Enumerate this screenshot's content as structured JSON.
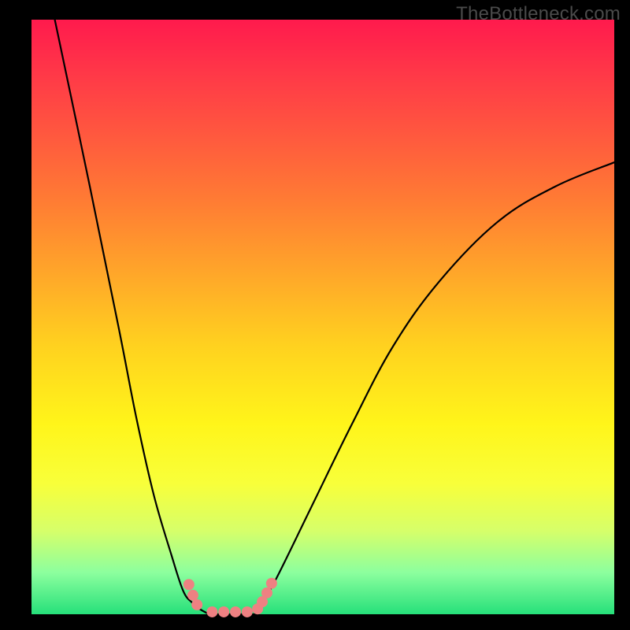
{
  "watermark": "TheBottleneck.com",
  "chart_data": {
    "type": "line",
    "title": "",
    "xlabel": "",
    "ylabel": "",
    "xlim": [
      0,
      100
    ],
    "ylim": [
      0,
      100
    ],
    "grid": false,
    "legend": false,
    "series": [
      {
        "name": "left-branch",
        "x": [
          4,
          10,
          15,
          18,
          21,
          24,
          26,
          27.5,
          29,
          30.5
        ],
        "values": [
          100,
          72,
          48,
          33,
          20,
          10,
          4,
          2,
          0.8,
          0
        ]
      },
      {
        "name": "bottom-trough",
        "x": [
          30.5,
          33,
          35,
          37,
          38.5
        ],
        "values": [
          0,
          0,
          0,
          0,
          0
        ]
      },
      {
        "name": "right-branch",
        "x": [
          38.5,
          42,
          48,
          55,
          62,
          70,
          80,
          90,
          100
        ],
        "values": [
          0,
          6,
          18,
          32,
          45,
          56,
          66,
          72,
          76
        ]
      }
    ],
    "markers": {
      "name": "threshold-dots",
      "color": "#ee8182",
      "points": [
        {
          "x": 27.0,
          "y": 5.0
        },
        {
          "x": 27.7,
          "y": 3.2
        },
        {
          "x": 28.4,
          "y": 1.6
        },
        {
          "x": 31.0,
          "y": 0.4
        },
        {
          "x": 33.0,
          "y": 0.4
        },
        {
          "x": 35.0,
          "y": 0.4
        },
        {
          "x": 37.0,
          "y": 0.4
        },
        {
          "x": 38.8,
          "y": 0.9
        },
        {
          "x": 39.6,
          "y": 2.1
        },
        {
          "x": 40.4,
          "y": 3.6
        },
        {
          "x": 41.2,
          "y": 5.2
        }
      ]
    }
  }
}
